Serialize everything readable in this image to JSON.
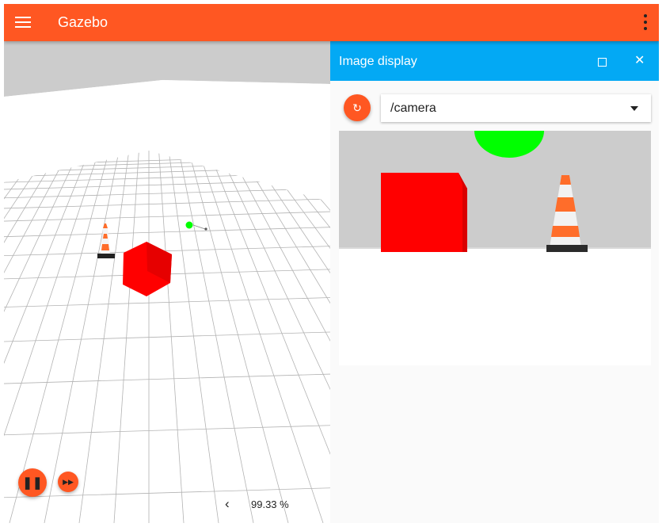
{
  "app": {
    "title": "Gazebo"
  },
  "icons": {
    "menu": "hamburger-menu-icon",
    "more": "vertical-dots-icon",
    "play_pause": "pause-icon",
    "step": "fast-forward-icon",
    "collapse": "chevron-left-icon",
    "refresh": "refresh-icon",
    "maximize": "maximize-icon",
    "close": "close-icon",
    "dropdown": "caret-down-icon"
  },
  "symbols": {
    "pause": "❚❚",
    "step": "▶▶",
    "chevron": "‹",
    "refresh": "↻",
    "close": "✕"
  },
  "colors": {
    "primary": "#ff5722",
    "accent": "#03a9f4"
  },
  "scene": {
    "real_time_factor": "99.33 %"
  },
  "image_display": {
    "title": "Image display",
    "topic": "/camera"
  }
}
